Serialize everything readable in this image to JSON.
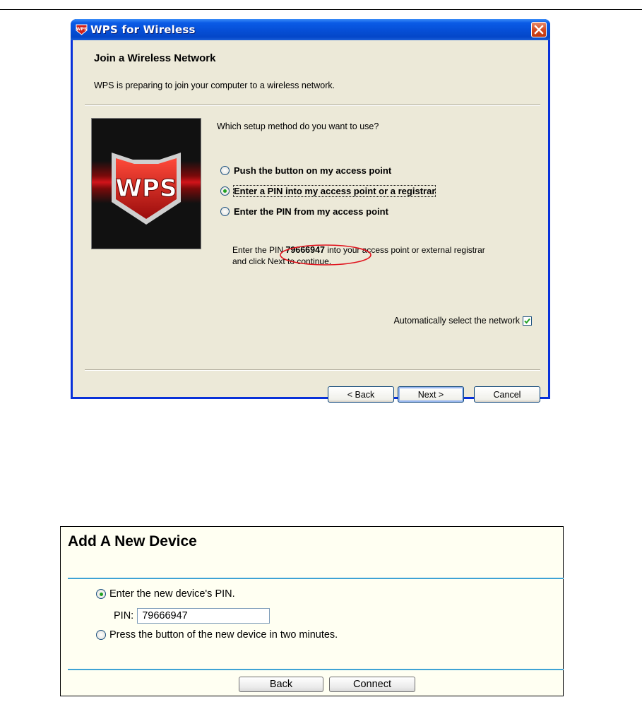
{
  "dialog": {
    "title": "WPS for Wireless",
    "heading": "Join a Wireless Network",
    "subtext": "WPS is preparing to join your computer to a wireless network.",
    "image_label": "WPS",
    "question": "Which setup method do you want to use?",
    "options": [
      {
        "label": "Push the button on my access point",
        "selected": false
      },
      {
        "label": "Enter a PIN into my access point or a registrar",
        "selected": true
      },
      {
        "label": "Enter the PIN from my access point",
        "selected": false
      }
    ],
    "instruction_prefix": "Enter the PIN ",
    "pin": "79666947",
    "instruction_suffix": " into your access point or external registrar",
    "instruction_line2": "and click Next to continue.",
    "auto_select_label": "Automatically select the network",
    "auto_select_checked": true,
    "buttons": {
      "back": "< Back",
      "next": "Next >",
      "cancel": "Cancel"
    },
    "colors": {
      "titlebar": "#0650d8",
      "client": "#ece9d8",
      "highlight_circle": "#e0141e"
    }
  },
  "router": {
    "title": "Add A New Device",
    "options": [
      {
        "label": "Enter the new device's PIN.",
        "selected": true
      },
      {
        "label": "Press the button of the new device in two minutes.",
        "selected": false
      }
    ],
    "pin_label": "PIN:",
    "pin_value": "79666947",
    "buttons": {
      "back": "Back",
      "connect": "Connect"
    },
    "colors": {
      "background": "#fffff2",
      "rule": "#3ea3d5"
    }
  }
}
